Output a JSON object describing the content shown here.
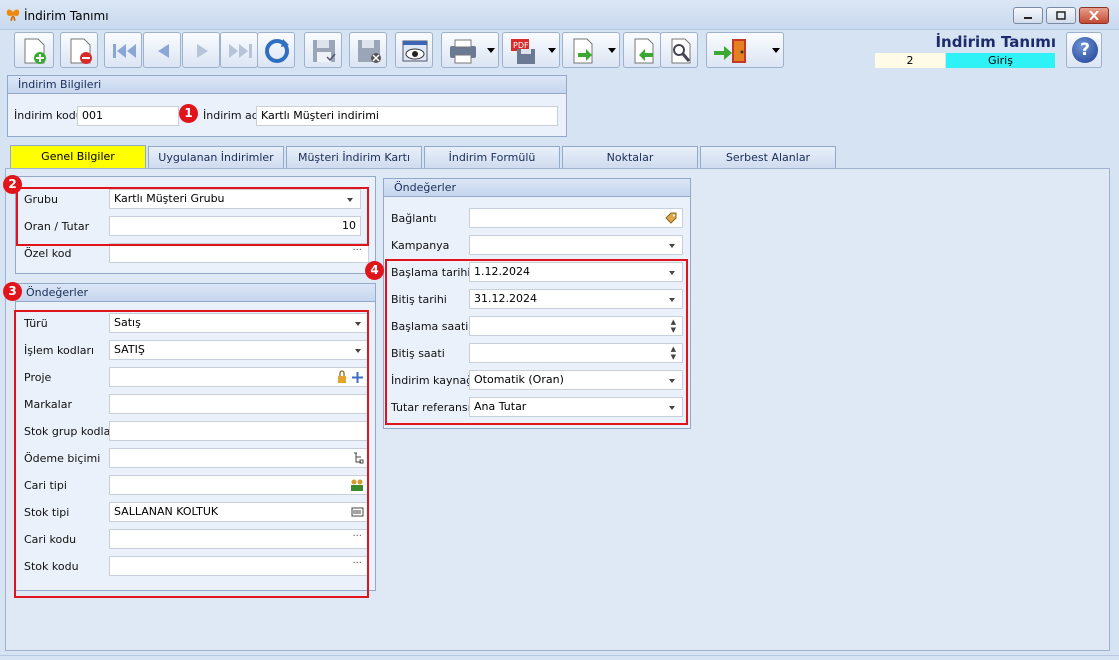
{
  "window": {
    "title": "İndirim Tanımı"
  },
  "header": {
    "title": "İndirim Tanımı",
    "record_count": "2",
    "mode": "Giriş"
  },
  "toolbar": {
    "buttons": [
      "new",
      "delete",
      "first",
      "previous",
      "next",
      "last",
      "refresh",
      "save",
      "cancel-save",
      "preview",
      "print",
      "pdf-export",
      "export",
      "import",
      "tools",
      "exit"
    ]
  },
  "indirim_bilgileri": {
    "section_title": "İndirim Bilgileri",
    "kod_label": "İndirim kodu",
    "kod_value": "001",
    "ad_label": "İndirim adı",
    "ad_value": "Kartlı Müşteri indirimi"
  },
  "tabs": [
    {
      "label": "Genel Bilgiler"
    },
    {
      "label": "Uygulanan İndirimler"
    },
    {
      "label": "Müşteri İndirim Kartı"
    },
    {
      "label": "İndirim Formülü"
    },
    {
      "label": "Noktalar"
    },
    {
      "label": "Serbest Alanlar"
    }
  ],
  "genel": {
    "grubu_label": "Grubu",
    "grubu_value": "Kartlı Müşteri Grubu",
    "oran_label": "Oran / Tutar",
    "oran_value": "10",
    "ozel_label": "Özel kod",
    "ozel_value": ""
  },
  "ondegerler_left": {
    "section_title": "Öndeğerler",
    "fields": [
      {
        "label": "Türü",
        "value": "Satış"
      },
      {
        "label": "İşlem kodları",
        "value": "SATIŞ"
      },
      {
        "label": "Proje",
        "value": ""
      },
      {
        "label": "Markalar",
        "value": ""
      },
      {
        "label": "Stok grup kodları",
        "value": ""
      },
      {
        "label": "Ödeme biçimi",
        "value": ""
      },
      {
        "label": "Cari tipi",
        "value": ""
      },
      {
        "label": "Stok tipi",
        "value": "SALLANAN KOLTUK"
      },
      {
        "label": "Cari kodu",
        "value": ""
      },
      {
        "label": "Stok kodu",
        "value": ""
      }
    ]
  },
  "ondegerler_right": {
    "section_title": "Öndeğerler",
    "fields": [
      {
        "label": "Bağlantı",
        "value": ""
      },
      {
        "label": "Kampanya",
        "value": ""
      },
      {
        "label": "Başlama tarihi",
        "value": "1.12.2024"
      },
      {
        "label": "Bitiş tarihi",
        "value": "31.12.2024"
      },
      {
        "label": "Başlama saati",
        "value": ""
      },
      {
        "label": "Bitiş saati",
        "value": ""
      },
      {
        "label": "İndirim kaynağı",
        "value": "Otomatik (Oran)"
      },
      {
        "label": "Tutar referansı",
        "value": "Ana Tutar"
      }
    ]
  },
  "annotations": [
    "1",
    "2",
    "3",
    "4"
  ],
  "colors": {
    "accent_red": "#e0141a",
    "active_tab": "#ffff00",
    "mode_bg": "#2ff2f6",
    "title_blue": "#1d2a6b"
  }
}
